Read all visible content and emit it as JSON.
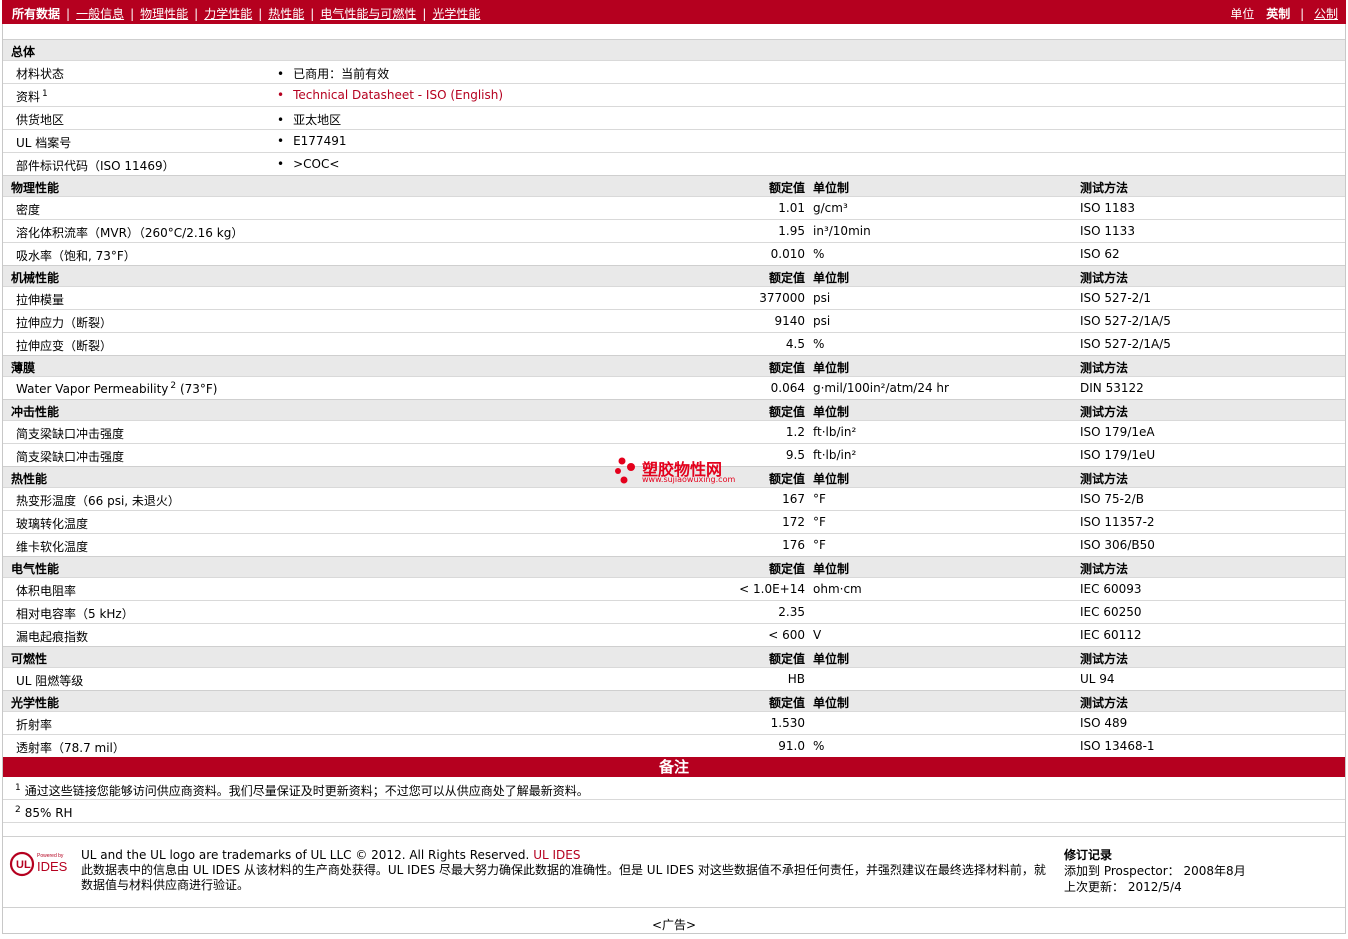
{
  "nav": {
    "items": [
      "所有数据",
      "一般信息",
      "物理性能",
      "力学性能",
      "热性能",
      "电气性能与可燃性",
      "光学性能"
    ],
    "units_label": "单位",
    "units_current": "英制",
    "units_other": "公制"
  },
  "general": {
    "title": "总体",
    "rows": [
      {
        "label": "材料状态",
        "sup": "",
        "value": "已商用：当前有效"
      },
      {
        "label": "资料",
        "sup": "1",
        "value": "Technical Datasheet - ISO (English)"
      },
      {
        "label": "供货地区",
        "sup": "",
        "value": "亚太地区"
      },
      {
        "label": "UL 档案号",
        "sup": "",
        "value": "E177491"
      },
      {
        "label": "部件标识代码（ISO 11469）",
        "sup": "",
        "value": ">COC<"
      }
    ]
  },
  "headers": {
    "value": "额定值",
    "unit": "单位制",
    "method": "测试方法"
  },
  "sections": [
    {
      "title": "物理性能",
      "rows": [
        {
          "label": "密度",
          "sup": "",
          "value": "1.01",
          "unit": "g/cm³",
          "method": "ISO 1183"
        },
        {
          "label": "溶化体积流率（MVR）（260°C/2.16 kg）",
          "sup": "",
          "value": "1.95",
          "unit": "in³/10min",
          "method": "ISO 1133"
        },
        {
          "label": "吸水率（饱和, 73°F）",
          "sup": "",
          "value": "0.010",
          "unit": "%",
          "method": "ISO 62"
        }
      ]
    },
    {
      "title": "机械性能",
      "rows": [
        {
          "label": "拉伸模量",
          "sup": "",
          "value": "377000",
          "unit": "psi",
          "method": "ISO 527-2/1"
        },
        {
          "label": "拉伸应力（断裂）",
          "sup": "",
          "value": "9140",
          "unit": "psi",
          "method": "ISO 527-2/1A/5"
        },
        {
          "label": "拉伸应变（断裂）",
          "sup": "",
          "value": "4.5",
          "unit": "%",
          "method": "ISO 527-2/1A/5"
        }
      ]
    },
    {
      "title": "薄膜",
      "rows": [
        {
          "label": "Water Vapor Permeability",
          "sup": "2",
          "suffix": " (73°F)",
          "value": "0.064",
          "unit": "g·mil/100in²/atm/24 hr",
          "method": "DIN 53122"
        }
      ]
    },
    {
      "title": "冲击性能",
      "rows": [
        {
          "label": "简支梁缺口冲击强度",
          "sup": "",
          "value": "1.2",
          "unit": "ft·lb/in²",
          "method": "ISO 179/1eA"
        },
        {
          "label": "简支梁缺口冲击强度",
          "sup": "",
          "value": "9.5",
          "unit": "ft·lb/in²",
          "method": "ISO 179/1eU"
        }
      ]
    },
    {
      "title": "热性能",
      "rows": [
        {
          "label": "热变形温度（66 psi, 未退火）",
          "sup": "",
          "value": "167",
          "unit": "°F",
          "method": "ISO 75-2/B"
        },
        {
          "label": "玻璃转化温度",
          "sup": "",
          "value": "172",
          "unit": "°F",
          "method": "ISO 11357-2"
        },
        {
          "label": "维卡软化温度",
          "sup": "",
          "value": "176",
          "unit": "°F",
          "method": "ISO 306/B50"
        }
      ]
    },
    {
      "title": "电气性能",
      "rows": [
        {
          "label": "体积电阻率",
          "sup": "",
          "value": "< 1.0E+14",
          "unit": "ohm·cm",
          "method": "IEC 60093"
        },
        {
          "label": "相对电容率（5 kHz）",
          "sup": "",
          "value": "2.35",
          "unit": "",
          "method": "IEC 60250"
        },
        {
          "label": "漏电起痕指数",
          "sup": "",
          "value": "< 600",
          "unit": "V",
          "method": "IEC 60112"
        }
      ]
    },
    {
      "title": "可燃性",
      "rows": [
        {
          "label": "UL 阻燃等级",
          "sup": "",
          "value": "HB",
          "unit": "",
          "method": "UL 94"
        }
      ]
    },
    {
      "title": "光学性能",
      "rows": [
        {
          "label": "折射率",
          "sup": "",
          "value": "1.530",
          "unit": "",
          "method": "ISO 489"
        },
        {
          "label": "透射率（78.7 mil）",
          "sup": "",
          "value": "91.0",
          "unit": "%",
          "method": "ISO 13468-1"
        }
      ]
    }
  ],
  "notes": {
    "title": "备注",
    "items": [
      {
        "num": "1",
        "text": "通过这些链接您能够访问供应商资料。我们尽量保证及时更新资料；不过您可以从供应商处了解最新资料。"
      },
      {
        "num": "2",
        "text": "85% RH"
      }
    ]
  },
  "footer": {
    "logo_small": "Powered by",
    "logo_text": "IDES",
    "trademark": "UL and the UL logo are trademarks of UL LLC © 2012. All Rights Reserved.",
    "trademark_link": "UL IDES",
    "disclaimer": "此数据表中的信息由 UL IDES 从该材料的生产商处获得。UL IDES 尽最大努力确保此数据的准确性。但是 UL IDES 对这些数据值不承担任何责任，并强烈建议在最终选择材料前，就数据值与材料供应商进行验证。",
    "rev_title": "修订记录",
    "added_label": "添加到 Prospector：",
    "added_value": "2008年8月",
    "updated_label": "上次更新：",
    "updated_value": "2012/5/4"
  },
  "ad": "<广告>",
  "watermark": {
    "title": "塑胶物性网",
    "url": "www.sujiaowuxing.com"
  },
  "colors": {
    "accent": "#b5001f",
    "section_bg": "#e9e9e9"
  }
}
